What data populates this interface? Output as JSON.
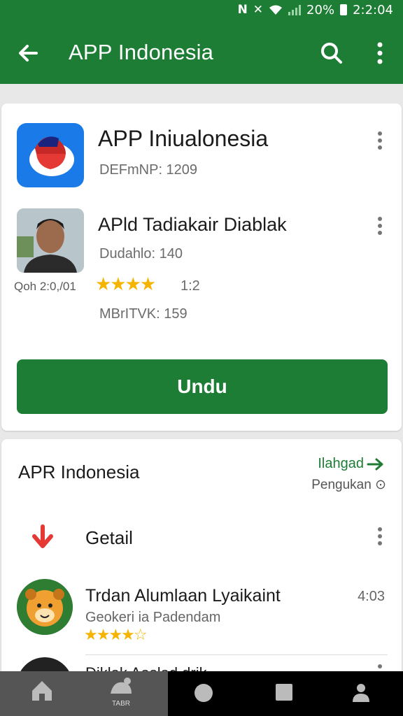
{
  "status_bar": {
    "battery": "20%",
    "time": "2:2:04"
  },
  "app_bar": {
    "title": "APP Indonesia"
  },
  "featured": {
    "app1": {
      "title": "APP Iniualonesia",
      "subtitle": "DEFmNP: 1209"
    },
    "app2": {
      "title": "APld Tadiakair Diablak",
      "line1": "Dudahlo: 140",
      "date": "Qoh 2:0,/01",
      "stars": "★★★★",
      "rating": "1:2",
      "line3": "MBrITVK: 159"
    },
    "install_button": "Undu"
  },
  "section": {
    "title": "APR Indonesia",
    "see_all": "Ilahgad",
    "sub": "Pengukan ⊙",
    "items": [
      {
        "title": "Getail"
      },
      {
        "title": "Trdan Alumlaan Lyaikaint",
        "subtitle": "Geokeri ia Padendam",
        "stars": "★★★★☆",
        "time": "4:03"
      },
      {
        "title": "Diklak Aaslad drik..."
      }
    ]
  },
  "bottom_nav": {
    "tab_b_label": "TABR"
  },
  "colors": {
    "primary_green": "#1e7d35",
    "star": "#f4b400"
  }
}
